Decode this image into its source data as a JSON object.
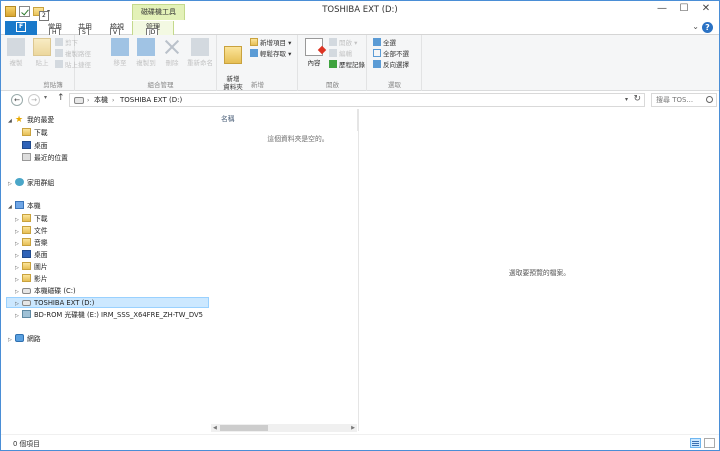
{
  "window": {
    "title": "TOSHIBA EXT (D:)",
    "context_tab_title": "磁碟機工具",
    "controls": {
      "minimize": "—",
      "maximize": "☐",
      "close": "✕"
    }
  },
  "keytips": {
    "quick_access": "2",
    "file": "F",
    "home": "H",
    "share": "S",
    "view": "V",
    "manage": "JD"
  },
  "tabs": {
    "file": "",
    "home": "常用",
    "share": "共用",
    "view": "檢視",
    "manage": "管理"
  },
  "ribbon": {
    "clipboard": {
      "label": "剪貼簿",
      "copy": "複製",
      "paste": "貼上",
      "cut": "剪下",
      "copy_path": "複製路徑",
      "paste_shortcut": "貼上捷徑"
    },
    "organize": {
      "label": "組合管理",
      "move_to": "移至",
      "copy_to": "複製到",
      "delete": "刪除",
      "rename": "重新命名"
    },
    "new": {
      "label": "新增",
      "new_folder": "新增\n資料夾",
      "new_item": "新增項目 ▾",
      "easy_access": "輕鬆存取 ▾"
    },
    "open": {
      "label": "開啟",
      "properties": "內容",
      "open": "開啟 ▾",
      "edit": "編輯",
      "history": "歷程記錄"
    },
    "select": {
      "label": "選取",
      "select_all": "全選",
      "select_none": "全部不選",
      "invert": "反向選擇"
    }
  },
  "address": {
    "back": "←",
    "forward": "→",
    "up": "↑",
    "crumbs": [
      "本機",
      "TOSHIBA EXT (D:)"
    ],
    "separator": "›",
    "refresh": "↻",
    "search_placeholder": "搜尋 TOS..."
  },
  "nav": {
    "favorites": "我的最愛",
    "downloads": "下載",
    "desktop": "桌面",
    "recent": "最近的位置",
    "homegroup": "家用群組",
    "this_pc": "本機",
    "pc_items": [
      "下載",
      "文件",
      "音樂",
      "桌面",
      "圖片",
      "影片"
    ],
    "local_disk": "本機磁碟 (C:)",
    "toshiba": "TOSHIBA EXT (D:)",
    "bd_rom": "BD-ROM 光碟機 (E:) IRM_SSS_X64FRE_ZH-TW_DV5",
    "network": "網路"
  },
  "filelist": {
    "column_name": "名稱",
    "empty_message": "這個資料夾是空的。"
  },
  "preview": {
    "message": "選取要預覽的檔案。"
  },
  "status": {
    "item_count": "0 個項目"
  }
}
